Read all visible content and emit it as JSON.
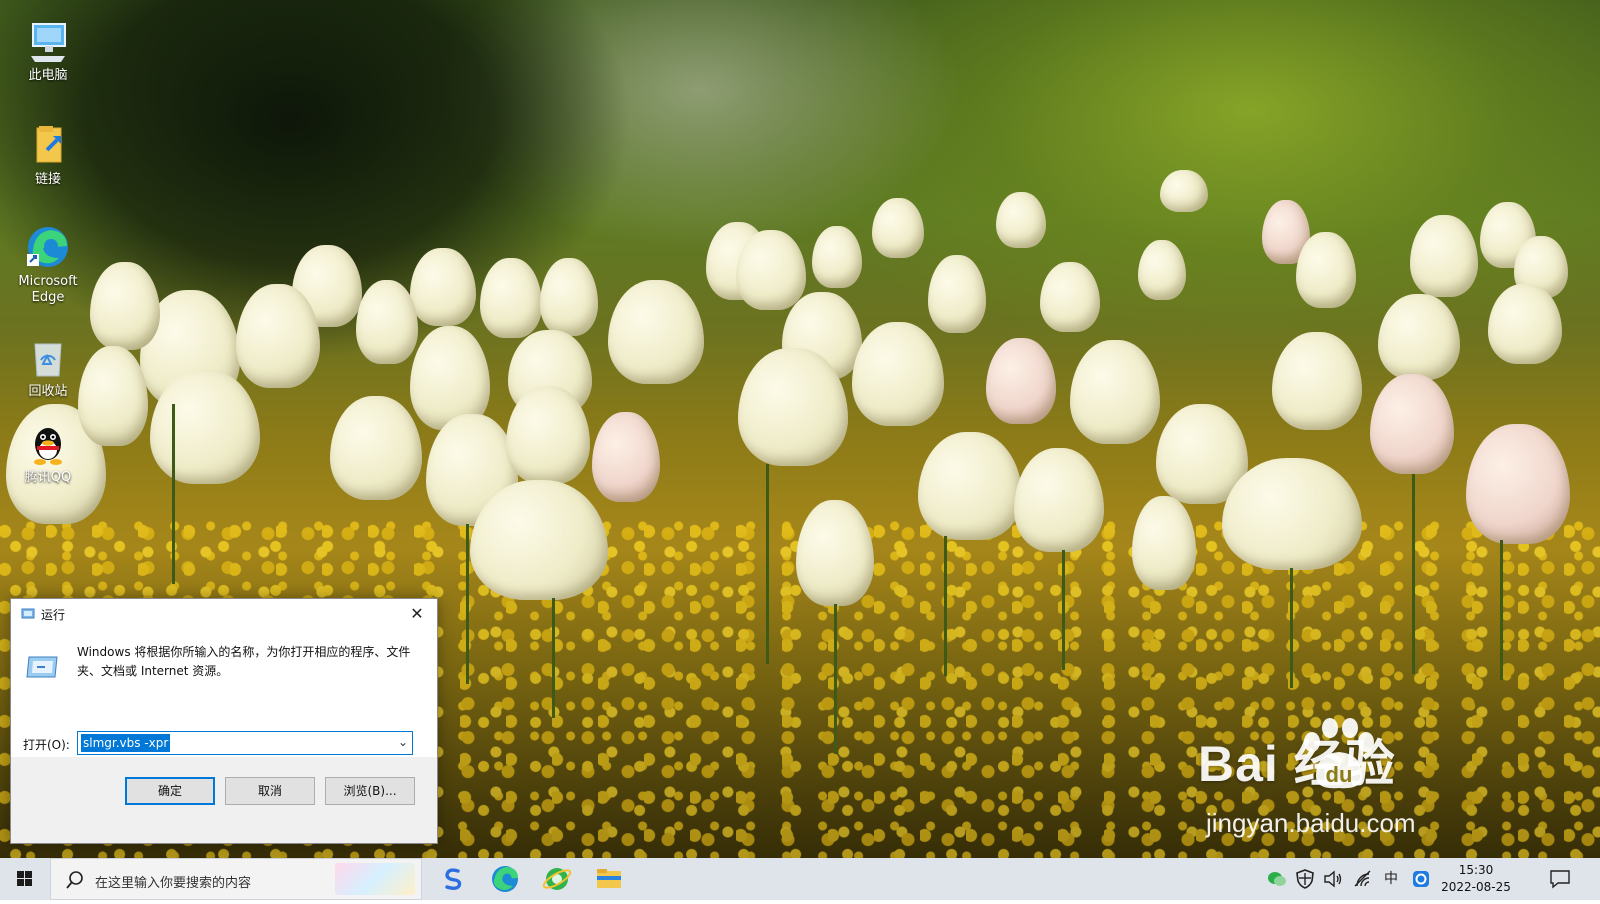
{
  "desktop": {
    "icons": [
      {
        "label": "此电脑",
        "icon": "computer-icon"
      },
      {
        "label": "链接",
        "icon": "folder-link-icon"
      },
      {
        "label": "Microsoft Edge",
        "icon": "edge-icon"
      },
      {
        "label": "回收站",
        "icon": "recycle-bin-icon"
      },
      {
        "label": "腾讯QQ",
        "icon": "qq-icon"
      }
    ]
  },
  "run_dialog": {
    "title": "运行",
    "close_glyph": "✕",
    "description": "Windows 将根据你所输入的名称，为你打开相应的程序、文件夹、文档或 Internet 资源。",
    "open_label": "打开(O):",
    "input_value": "slmgr.vbs -xpr",
    "ok_label": "确定",
    "cancel_label": "取消",
    "browse_label": "浏览(B)...",
    "accent_color": "#0078d7"
  },
  "watermark": {
    "brand": "Bai  经验",
    "url": "jingyan.baidu.com"
  },
  "taskbar": {
    "search_placeholder": "在这里输入你要搜索的内容",
    "pinned_apps": [
      "sogou-input-icon",
      "edge-icon",
      "ie-browser-icon",
      "file-explorer-icon"
    ],
    "tray": [
      "wechat-icon",
      "security-shield-icon",
      "volume-icon",
      "network-icon",
      "ime-icon",
      "app-tray-icon"
    ],
    "ime_label": "中",
    "time": "15:30",
    "date": "2022-08-25"
  }
}
